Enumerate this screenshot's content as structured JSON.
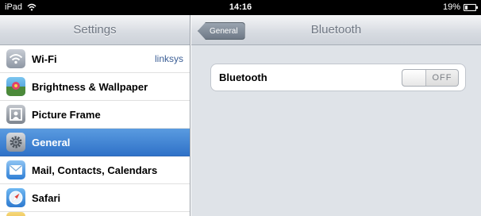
{
  "status_bar": {
    "device": "iPad",
    "time": "14:16",
    "battery": "19%",
    "battery_level": 0.19
  },
  "master": {
    "title": "Settings",
    "items": [
      {
        "label": "Wi-Fi",
        "value": "linksys",
        "icon": "wifi-icon",
        "selected": false
      },
      {
        "label": "Brightness & Wallpaper",
        "value": "",
        "icon": "brightness-wallpaper-icon",
        "selected": false
      },
      {
        "label": "Picture Frame",
        "value": "",
        "icon": "picture-frame-icon",
        "selected": false
      },
      {
        "label": "General",
        "value": "",
        "icon": "gear-icon",
        "selected": true
      },
      {
        "label": "Mail, Contacts, Calendars",
        "value": "",
        "icon": "mail-icon",
        "selected": false
      },
      {
        "label": "Safari",
        "value": "",
        "icon": "safari-icon",
        "selected": false
      }
    ]
  },
  "detail": {
    "title": "Bluetooth",
    "back_label": "General",
    "bluetooth_row": {
      "label": "Bluetooth",
      "toggle_state": "OFF"
    }
  }
}
